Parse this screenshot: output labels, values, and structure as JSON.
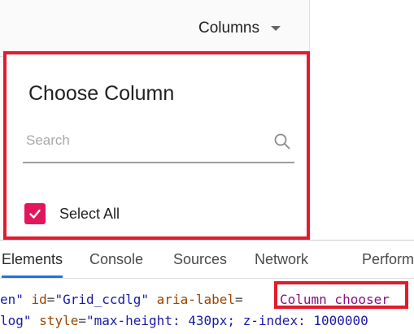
{
  "toolbar": {
    "columns_label": "Columns"
  },
  "dialog": {
    "title": "Choose Column",
    "search_placeholder": "Search",
    "select_all_label": "Select All",
    "select_all_checked": true,
    "accent_color": "#e3165b",
    "highlight_color": "#e21b2e"
  },
  "devtools": {
    "tabs": [
      {
        "label": "Elements",
        "active": true
      },
      {
        "label": "Console",
        "active": false
      },
      {
        "label": "Sources",
        "active": false
      },
      {
        "label": "Network",
        "active": false
      },
      {
        "label": "Perform",
        "active": false
      }
    ],
    "line1": {
      "prefix": "en\" ",
      "id_attr": "id",
      "id_val": "\"Grid_ccdlg\"",
      "aria_attr": "aria-label",
      "aria_val": "Column chooser"
    },
    "line2": {
      "prefix": "log\" ",
      "style_attr": "style",
      "style_val": "\"max-height: 430px; z-index: 1000000"
    }
  }
}
